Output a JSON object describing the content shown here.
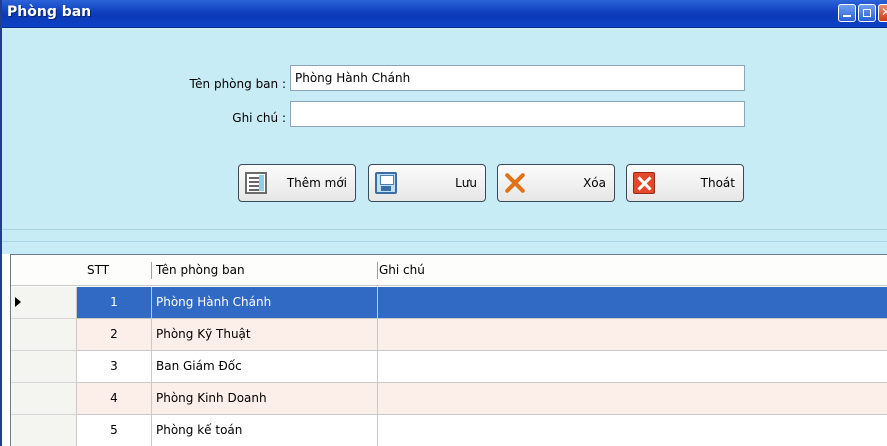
{
  "window": {
    "title": "Phòng ban"
  },
  "form": {
    "name_label": "Tên phòng ban :",
    "name_value": "Phòng Hành Chánh",
    "note_label": "Ghi chú :",
    "note_value": ""
  },
  "buttons": {
    "add": "Thêm mới",
    "save": "Lưu",
    "delete": "Xóa",
    "exit": "Thoát"
  },
  "grid": {
    "columns": [
      "STT",
      "Tên phòng ban",
      "Ghi chú"
    ],
    "rows": [
      {
        "stt": "1",
        "name": "Phòng Hành Chánh",
        "note": "",
        "selected": true
      },
      {
        "stt": "2",
        "name": "Phòng Kỹ Thuật",
        "note": ""
      },
      {
        "stt": "3",
        "name": "Ban Giám Đốc",
        "note": ""
      },
      {
        "stt": "4",
        "name": "Phòng Kinh Doanh",
        "note": ""
      },
      {
        "stt": "5",
        "name": "Phòng kế toán",
        "note": ""
      }
    ]
  },
  "colors": {
    "titlebar": "#0e3fbf",
    "panel": "#c7ecf6",
    "selection": "#316ac5",
    "alt_row": "#fceee8"
  },
  "icons": {
    "add": "new-document-icon",
    "save": "floppy-disk-icon",
    "delete": "orange-x-icon",
    "exit": "red-close-icon"
  }
}
